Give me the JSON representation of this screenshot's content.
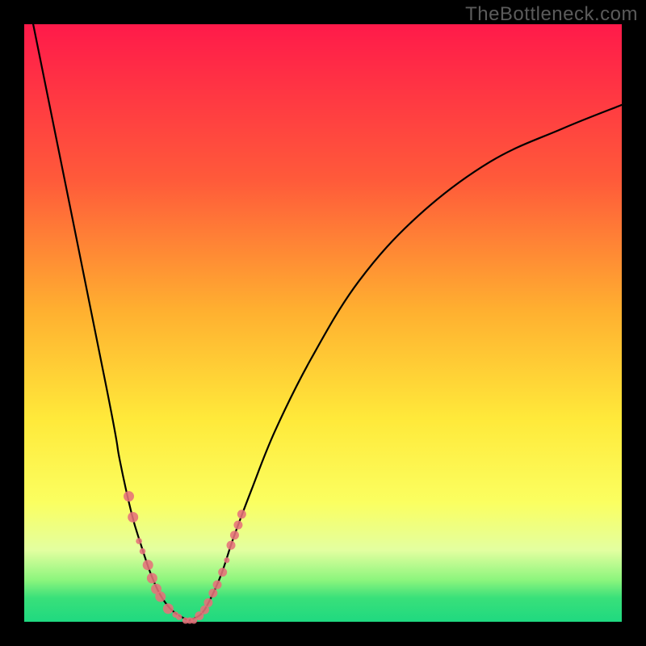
{
  "watermark": {
    "text": "TheBottleneck.com"
  },
  "chart_data": {
    "type": "line",
    "title": "",
    "xlabel": "",
    "ylabel": "",
    "xlim": [
      0,
      100
    ],
    "ylim": [
      0,
      100
    ],
    "curves": [
      {
        "name": "left-branch",
        "points": [
          {
            "x": 1.5,
            "y": 100
          },
          {
            "x": 13.7,
            "y": 39.5
          },
          {
            "x": 16,
            "y": 27
          },
          {
            "x": 18,
            "y": 18
          },
          {
            "x": 19.5,
            "y": 13
          },
          {
            "x": 21,
            "y": 8.5
          },
          {
            "x": 22.5,
            "y": 5
          },
          {
            "x": 24,
            "y": 2.7
          },
          {
            "x": 25.5,
            "y": 1.3
          },
          {
            "x": 27.5,
            "y": 0.2
          }
        ]
      },
      {
        "name": "right-branch",
        "points": [
          {
            "x": 27.5,
            "y": 0.2
          },
          {
            "x": 29.5,
            "y": 1.2
          },
          {
            "x": 31,
            "y": 3.5
          },
          {
            "x": 33,
            "y": 8
          },
          {
            "x": 35,
            "y": 14
          },
          {
            "x": 38,
            "y": 22
          },
          {
            "x": 42,
            "y": 32
          },
          {
            "x": 48,
            "y": 44
          },
          {
            "x": 56,
            "y": 57
          },
          {
            "x": 66,
            "y": 68
          },
          {
            "x": 78,
            "y": 77
          },
          {
            "x": 90,
            "y": 82.5
          },
          {
            "x": 100,
            "y": 86.5
          }
        ]
      }
    ],
    "series": [
      {
        "name": "markers-left-large",
        "r": 6.5,
        "points": [
          {
            "x": 17.5,
            "y": 21
          },
          {
            "x": 18.2,
            "y": 17.5
          },
          {
            "x": 20.7,
            "y": 9.5
          },
          {
            "x": 21.4,
            "y": 7.3
          },
          {
            "x": 22.1,
            "y": 5.5
          },
          {
            "x": 22.8,
            "y": 4.2
          },
          {
            "x": 24.1,
            "y": 2.2
          }
        ]
      },
      {
        "name": "markers-left-small",
        "r": 3.8,
        "points": [
          {
            "x": 19.2,
            "y": 13.5
          },
          {
            "x": 19.8,
            "y": 11.8
          },
          {
            "x": 25.3,
            "y": 1.2
          },
          {
            "x": 25.9,
            "y": 0.8
          }
        ]
      },
      {
        "name": "markers-bottom",
        "r": 4,
        "points": [
          {
            "x": 27,
            "y": 0.2
          },
          {
            "x": 27.7,
            "y": 0.2
          },
          {
            "x": 28.4,
            "y": 0.2
          }
        ]
      },
      {
        "name": "markers-right",
        "r": 5.5,
        "points": [
          {
            "x": 29.3,
            "y": 1.0
          },
          {
            "x": 30.2,
            "y": 2.0
          },
          {
            "x": 30.8,
            "y": 3.2
          },
          {
            "x": 31.6,
            "y": 4.8
          },
          {
            "x": 32.3,
            "y": 6.2
          },
          {
            "x": 33.2,
            "y": 8.3
          },
          {
            "x": 34.6,
            "y": 12.8
          },
          {
            "x": 35.2,
            "y": 14.5
          },
          {
            "x": 35.8,
            "y": 16.2
          },
          {
            "x": 36.4,
            "y": 18
          }
        ]
      },
      {
        "name": "markers-right-small",
        "r": 3.5,
        "points": [
          {
            "x": 33.9,
            "y": 10.3
          }
        ]
      }
    ]
  }
}
